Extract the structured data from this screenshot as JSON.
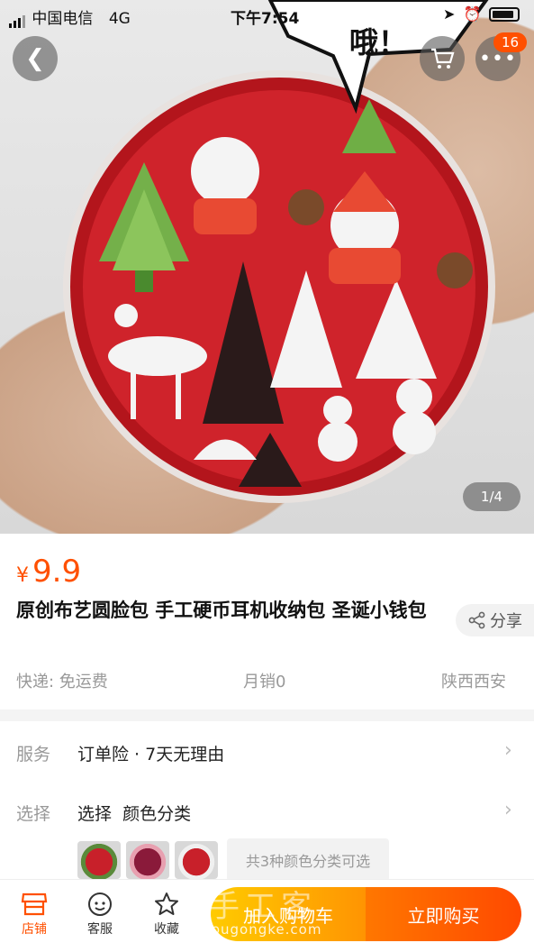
{
  "status_bar": {
    "carrier": "中国电信",
    "network": "4G",
    "time": "下午7:54"
  },
  "header": {
    "cart_badge": "16"
  },
  "hero": {
    "speech_text": "哦！",
    "page_indicator": "1/4"
  },
  "product": {
    "currency": "¥",
    "price": "9.9",
    "title": "原创布艺圆脸包 手工硬币耳机收纳包 圣诞小钱包",
    "share_label": "分享",
    "shipping": "快递: 免运费",
    "monthly_sales": "月销0",
    "location": "陕西西安"
  },
  "service": {
    "service_label": "服务",
    "service_value": "订单险 · 7天无理由",
    "select_label": "选择",
    "select_value": "选择  颜色分类",
    "variants_note": "共3种颜色分类可选"
  },
  "bottom_bar": {
    "store_label": "店铺",
    "support_label": "客服",
    "favorite_label": "收藏",
    "add_to_cart": "加入购物车",
    "buy_now": "立即购买"
  },
  "watermark": {
    "text": "手工客",
    "url": "shougongke.com"
  },
  "colors": {
    "accent": "#ff5000",
    "pouch_red": "#c8202a"
  }
}
